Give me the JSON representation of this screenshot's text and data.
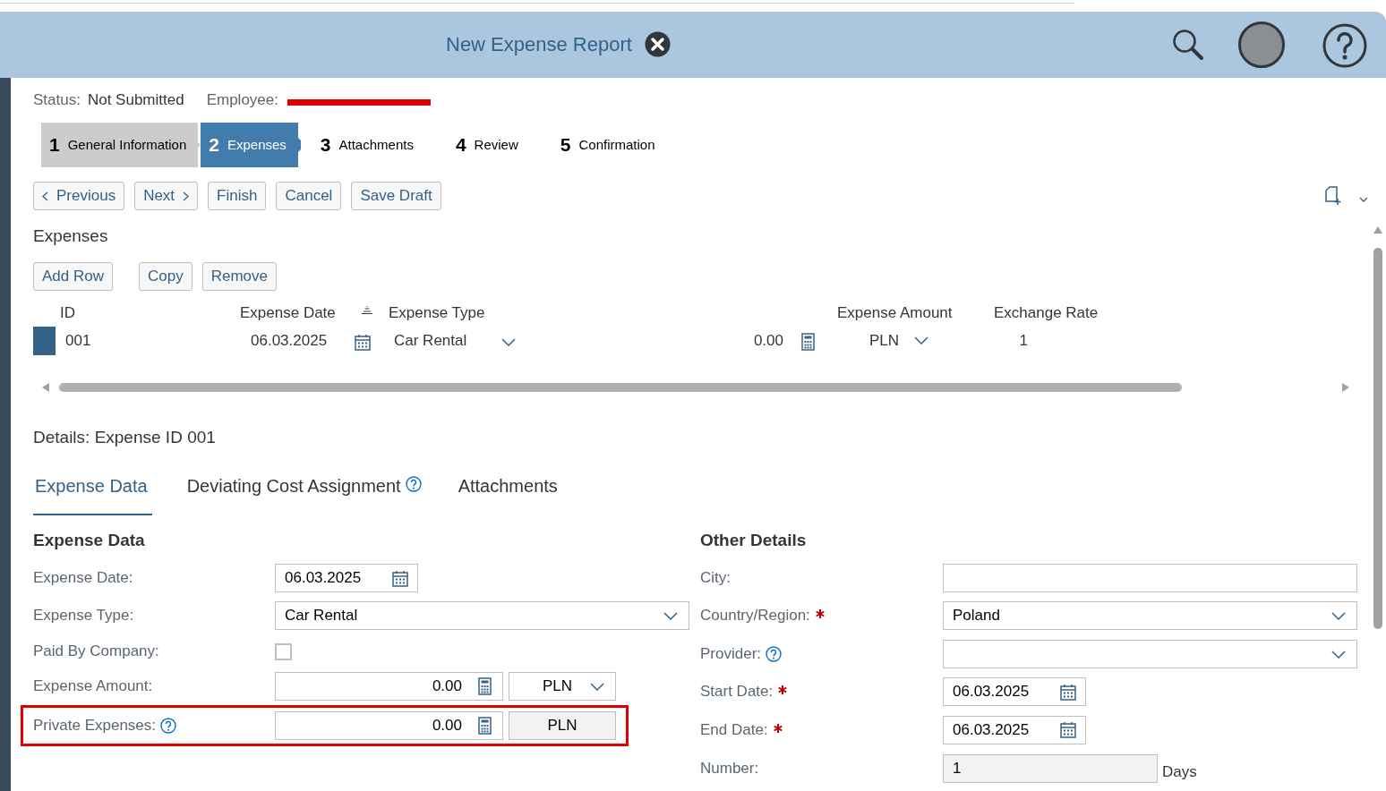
{
  "header": {
    "title": "New Expense Report"
  },
  "status": {
    "status_label": "Status:",
    "status_value": "Not Submitted",
    "employee_label": "Employee:"
  },
  "steps": [
    {
      "number": "1",
      "label": "General Information",
      "completed": true,
      "selected": false
    },
    {
      "number": "2",
      "label": "Expenses",
      "completed": false,
      "selected": true
    },
    {
      "number": "3",
      "label": "Attachments",
      "completed": false,
      "selected": false
    },
    {
      "number": "4",
      "label": "Review",
      "completed": false,
      "selected": false
    },
    {
      "number": "5",
      "label": "Confirmation",
      "completed": false,
      "selected": false
    }
  ],
  "nav_buttons": [
    {
      "label": "Previous",
      "kind": "prev"
    },
    {
      "label": "Next",
      "kind": "next"
    },
    {
      "label": "Finish",
      "kind": "plain"
    },
    {
      "label": "Cancel",
      "kind": "plain"
    },
    {
      "label": "Save Draft",
      "kind": "plain"
    }
  ],
  "expenses": {
    "title": "Expenses",
    "buttons": [
      "Add Row",
      "Copy",
      "Remove"
    ],
    "columns": [
      "ID",
      "Expense Date",
      "Expense Type",
      "Expense Amount",
      "Exchange Rate"
    ],
    "rows": [
      {
        "selected": true,
        "id": "001",
        "date": "06.03.2025",
        "type": "Car Rental",
        "amount": "0.00",
        "currency": "PLN",
        "rate": "1"
      }
    ]
  },
  "details": {
    "title": "Details: Expense ID 001",
    "tabs": [
      {
        "label": "Expense Data",
        "selected": true,
        "help": false
      },
      {
        "label": "Deviating Cost Assignment",
        "selected": false,
        "help": true
      },
      {
        "label": "Attachments",
        "selected": false,
        "help": false
      }
    ]
  },
  "expense_data": {
    "title": "Expense Data",
    "rows": [
      {
        "label": "Expense Date:",
        "kind": "date",
        "value": "06.03.2025",
        "help": false,
        "highlighted": false
      },
      {
        "label": "Expense Type:",
        "kind": "select",
        "value": "Car Rental",
        "help": false,
        "highlighted": false
      },
      {
        "label": "Paid By Company:",
        "kind": "checkbox",
        "checked": false,
        "help": false,
        "highlighted": false
      },
      {
        "label": "Expense Amount:",
        "kind": "amount",
        "value": "0.00",
        "currency": "PLN",
        "currency_editable": true,
        "help": false,
        "highlighted": false
      },
      {
        "label": "Private Expenses:",
        "kind": "amount",
        "value": "0.00",
        "currency": "PLN",
        "currency_editable": false,
        "help": true,
        "highlighted": true
      }
    ]
  },
  "other_details": {
    "title": "Other Details",
    "rows": [
      {
        "label": "City:",
        "kind": "text",
        "value": "",
        "required": false,
        "help": false
      },
      {
        "label": "Country/Region:",
        "kind": "select",
        "value": "Poland",
        "required": true,
        "help": false
      },
      {
        "label": "Provider:",
        "kind": "select",
        "value": "",
        "required": false,
        "help": true
      },
      {
        "label": "Start Date:",
        "kind": "date",
        "value": "06.03.2025",
        "required": true,
        "help": false
      },
      {
        "label": "End Date:",
        "kind": "date",
        "value": "06.03.2025",
        "required": true,
        "help": false
      },
      {
        "label": "Number:",
        "kind": "readonly",
        "value": "1",
        "unit": "Days",
        "required": false,
        "help": false
      }
    ]
  }
}
